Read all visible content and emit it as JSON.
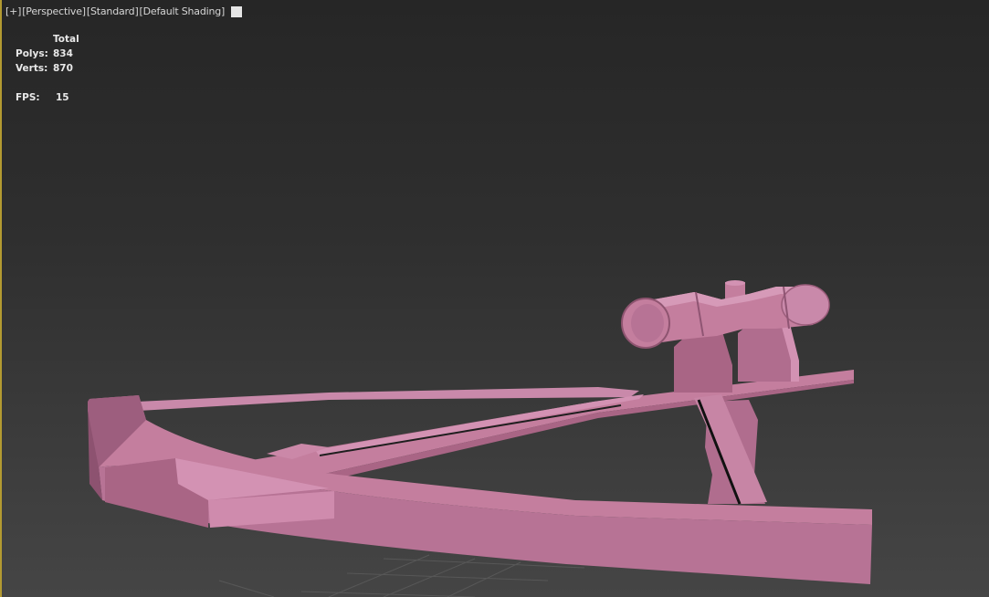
{
  "viewport": {
    "labels": [
      "[+]",
      "[Perspective]",
      "[Standard]",
      "[Default Shading]"
    ],
    "active_border_color": "#b39a31"
  },
  "stats": {
    "header": "Total",
    "polys_label": "Polys:",
    "polys_value": "834",
    "verts_label": "Verts:",
    "verts_value": "870",
    "fps_label": "FPS:",
    "fps_value": "15"
  },
  "model": {
    "name": "crossbow",
    "color": "#c47e9e"
  },
  "icons": [
    "viewport-options-square-icon"
  ]
}
